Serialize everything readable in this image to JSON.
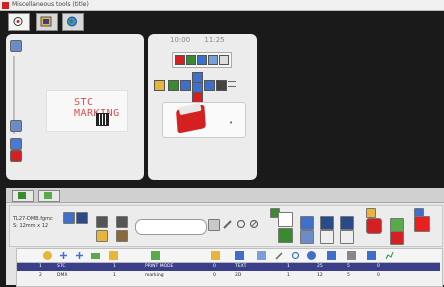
{
  "window": {
    "title": "Miscellaneous tools (title)"
  },
  "marking": {
    "preview_text": "STC MARKING",
    "clock_time_a": "10:00",
    "clock_time_b": "11:25"
  },
  "file": {
    "name_line": "TL27-DMB.fgmc",
    "size_line": "S: 12mm x 12"
  },
  "table": {
    "rows": [
      {
        "n": "1",
        "c1": "STC",
        "c2": "1",
        "c3": "PRINT MODE",
        "c4": "0",
        "c5": "TEXT",
        "c6": "1",
        "c7": "25",
        "c8": "5",
        "c9": "0"
      },
      {
        "n": "2",
        "c1": "DMX",
        "c2": "1",
        "c3": "marking",
        "c4": "0",
        "c5": "2D",
        "c6": "1",
        "c7": "12",
        "c8": "5",
        "c9": "0"
      }
    ]
  },
  "colors": {
    "accent_red": "#d42020",
    "accent_blue": "#3f6fc8",
    "accent_green": "#3a8a30",
    "panel_bg": "#ececec",
    "selection": "#3b3f8a"
  }
}
